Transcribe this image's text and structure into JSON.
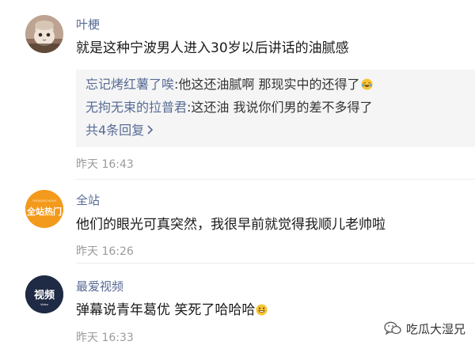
{
  "comments": [
    {
      "username": "叶梗",
      "avatar_icon": "cat-photo-avatar",
      "text": "就是这种宁波男人进入30岁以后讲话的油腻感",
      "replies": [
        {
          "name": "忘记烤红薯了唉",
          "sep": ":",
          "text": "他这还油腻啊 那现实中的还得了",
          "emoji": "laughing-tears-emoji"
        },
        {
          "name": "无拘无束的拉普君",
          "sep": ":",
          "text": "这还油 我说你们男的差不多得了"
        }
      ],
      "more_replies": "共4条回复",
      "more_replies_icon": "chevron-right-icon",
      "time": "昨天 16:43"
    },
    {
      "username": "全站",
      "avatar_icon": "quanzhan-hot-logo-avatar",
      "avatar_text_top": "TRENDING NEWS",
      "avatar_text": "全站热门",
      "text": "他们的眼光可真突然，我很早前就觉得我顺儿老帅啦",
      "time": "昨天 16:26"
    },
    {
      "username": "最爱视频",
      "avatar_icon": "video-logo-avatar",
      "avatar_text": "视频",
      "avatar_subtext": "Video",
      "text": "弹幕说青年葛优 笑死了哈哈哈",
      "emoji": "grinning-face-emoji",
      "time": "昨天 16:33"
    }
  ],
  "watermark": {
    "icon": "wechat-logo-icon",
    "text": "吃瓜大湿兄"
  },
  "colors": {
    "name_blue": "#576b95",
    "text": "#1a1a1a",
    "time_gray": "#9b9b9b",
    "reply_bg": "#f5f5f5",
    "orange_avatar": "#f39a1d"
  }
}
